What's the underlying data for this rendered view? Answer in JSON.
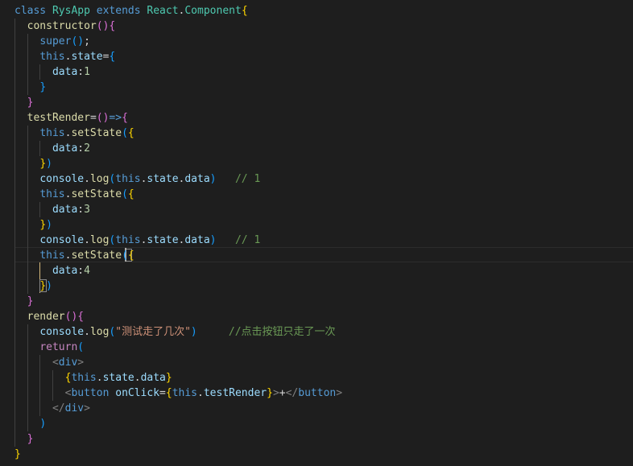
{
  "editor": {
    "language": "javascript-jsx",
    "theme_colors": {
      "background": "#1e1e1e",
      "keyword": "#569cd6",
      "control": "#c586c0",
      "class": "#4ec9b0",
      "function": "#dcdcaa",
      "property": "#9cdcfe",
      "number": "#b5cea8",
      "string": "#ce9178",
      "comment": "#6a9955",
      "bracket_level1": "#ffd700",
      "bracket_level2": "#da70d6",
      "bracket_level3": "#179fff"
    },
    "cursor_line": 17,
    "lines": [
      [
        [
          "kw",
          "class"
        ],
        [
          "txt",
          " "
        ],
        [
          "cls",
          "RysApp"
        ],
        [
          "txt",
          " "
        ],
        [
          "kw",
          "extends"
        ],
        [
          "txt",
          " "
        ],
        [
          "cls",
          "React"
        ],
        [
          "txt",
          "."
        ],
        [
          "cls",
          "Component"
        ],
        [
          "br1",
          "{"
        ]
      ],
      [
        [
          "txt",
          "  "
        ],
        [
          "fn",
          "constructor"
        ],
        [
          "br2",
          "()"
        ],
        [
          "br2",
          "{"
        ]
      ],
      [
        [
          "txt",
          "    "
        ],
        [
          "kw",
          "super"
        ],
        [
          "br3",
          "()"
        ],
        [
          "txt",
          ";"
        ]
      ],
      [
        [
          "txt",
          "    "
        ],
        [
          "kw",
          "this"
        ],
        [
          "txt",
          "."
        ],
        [
          "prop",
          "state"
        ],
        [
          "txt",
          "="
        ],
        [
          "br3",
          "{"
        ]
      ],
      [
        [
          "txt",
          "      "
        ],
        [
          "prop",
          "data"
        ],
        [
          "txt",
          ":"
        ],
        [
          "num",
          "1"
        ]
      ],
      [
        [
          "txt",
          "    "
        ],
        [
          "br3",
          "}"
        ]
      ],
      [
        [
          "txt",
          "  "
        ],
        [
          "br2",
          "}"
        ]
      ],
      [
        [
          "txt",
          "  "
        ],
        [
          "fn",
          "testRender"
        ],
        [
          "txt",
          "="
        ],
        [
          "br2",
          "()"
        ],
        [
          "kw",
          "=>"
        ],
        [
          "br2",
          "{"
        ]
      ],
      [
        [
          "txt",
          "    "
        ],
        [
          "kw",
          "this"
        ],
        [
          "txt",
          "."
        ],
        [
          "fn",
          "setState"
        ],
        [
          "br3",
          "("
        ],
        [
          "br1",
          "{"
        ]
      ],
      [
        [
          "txt",
          "      "
        ],
        [
          "prop",
          "data"
        ],
        [
          "txt",
          ":"
        ],
        [
          "num",
          "2"
        ]
      ],
      [
        [
          "txt",
          "    "
        ],
        [
          "br1",
          "}"
        ],
        [
          "br3",
          ")"
        ]
      ],
      [
        [
          "txt",
          "    "
        ],
        [
          "prop",
          "console"
        ],
        [
          "txt",
          "."
        ],
        [
          "fn",
          "log"
        ],
        [
          "br3",
          "("
        ],
        [
          "kw",
          "this"
        ],
        [
          "txt",
          "."
        ],
        [
          "prop",
          "state"
        ],
        [
          "txt",
          "."
        ],
        [
          "prop",
          "data"
        ],
        [
          "br3",
          ")"
        ],
        [
          "txt",
          "   "
        ],
        [
          "cmt",
          "// 1"
        ]
      ],
      [
        [
          "txt",
          "    "
        ],
        [
          "kw",
          "this"
        ],
        [
          "txt",
          "."
        ],
        [
          "fn",
          "setState"
        ],
        [
          "br3",
          "("
        ],
        [
          "br1",
          "{"
        ]
      ],
      [
        [
          "txt",
          "      "
        ],
        [
          "prop",
          "data"
        ],
        [
          "txt",
          ":"
        ],
        [
          "num",
          "3"
        ]
      ],
      [
        [
          "txt",
          "    "
        ],
        [
          "br1",
          "}"
        ],
        [
          "br3",
          ")"
        ]
      ],
      [
        [
          "txt",
          "    "
        ],
        [
          "prop",
          "console"
        ],
        [
          "txt",
          "."
        ],
        [
          "fn",
          "log"
        ],
        [
          "br3",
          "("
        ],
        [
          "kw",
          "this"
        ],
        [
          "txt",
          "."
        ],
        [
          "prop",
          "state"
        ],
        [
          "txt",
          "."
        ],
        [
          "prop",
          "data"
        ],
        [
          "br3",
          ")"
        ],
        [
          "txt",
          "   "
        ],
        [
          "cmt",
          "// 1"
        ]
      ],
      [
        [
          "txt",
          "    "
        ],
        [
          "kw",
          "this"
        ],
        [
          "txt",
          "."
        ],
        [
          "fn",
          "setState"
        ],
        [
          "br3",
          "("
        ],
        [
          "br1",
          "{"
        ]
      ],
      [
        [
          "txt",
          "      "
        ],
        [
          "prop",
          "data"
        ],
        [
          "txt",
          ":"
        ],
        [
          "num",
          "4"
        ]
      ],
      [
        [
          "txt",
          "    "
        ],
        [
          "br1",
          "}"
        ],
        [
          "br3",
          ")"
        ]
      ],
      [
        [
          "txt",
          "  "
        ],
        [
          "br2",
          "}"
        ]
      ],
      [
        [
          "txt",
          "  "
        ],
        [
          "fn",
          "render"
        ],
        [
          "br2",
          "()"
        ],
        [
          "br2",
          "{"
        ]
      ],
      [
        [
          "txt",
          "    "
        ],
        [
          "prop",
          "console"
        ],
        [
          "txt",
          "."
        ],
        [
          "fn",
          "log"
        ],
        [
          "br3",
          "("
        ],
        [
          "str",
          "\"测试走了几次\""
        ],
        [
          "br3",
          ")"
        ],
        [
          "txt",
          "     "
        ],
        [
          "cmt",
          "//点击按钮只走了一次"
        ]
      ],
      [
        [
          "txt",
          "    "
        ],
        [
          "ctl",
          "return"
        ],
        [
          "br3",
          "("
        ]
      ],
      [
        [
          "txt",
          "      "
        ],
        [
          "ang",
          "<"
        ],
        [
          "tag",
          "div"
        ],
        [
          "ang",
          ">"
        ]
      ],
      [
        [
          "txt",
          "        "
        ],
        [
          "br1",
          "{"
        ],
        [
          "kw",
          "this"
        ],
        [
          "txt",
          "."
        ],
        [
          "prop",
          "state"
        ],
        [
          "txt",
          "."
        ],
        [
          "prop",
          "data"
        ],
        [
          "br1",
          "}"
        ]
      ],
      [
        [
          "txt",
          "        "
        ],
        [
          "ang",
          "<"
        ],
        [
          "tag",
          "button"
        ],
        [
          "txt",
          " "
        ],
        [
          "prop",
          "onClick"
        ],
        [
          "txt",
          "="
        ],
        [
          "br1",
          "{"
        ],
        [
          "kw",
          "this"
        ],
        [
          "txt",
          "."
        ],
        [
          "prop",
          "testRender"
        ],
        [
          "br1",
          "}"
        ],
        [
          "ang",
          ">"
        ],
        [
          "txt",
          "+"
        ],
        [
          "ang",
          "</"
        ],
        [
          "tag",
          "button"
        ],
        [
          "ang",
          ">"
        ]
      ],
      [
        [
          "txt",
          "      "
        ],
        [
          "ang",
          "</"
        ],
        [
          "tag",
          "div"
        ],
        [
          "ang",
          ">"
        ]
      ],
      [
        [
          "txt",
          "    "
        ],
        [
          "br3",
          ")"
        ]
      ],
      [
        [
          "txt",
          "  "
        ],
        [
          "br2",
          "}"
        ]
      ],
      [
        [
          "br1",
          "}"
        ]
      ]
    ]
  }
}
